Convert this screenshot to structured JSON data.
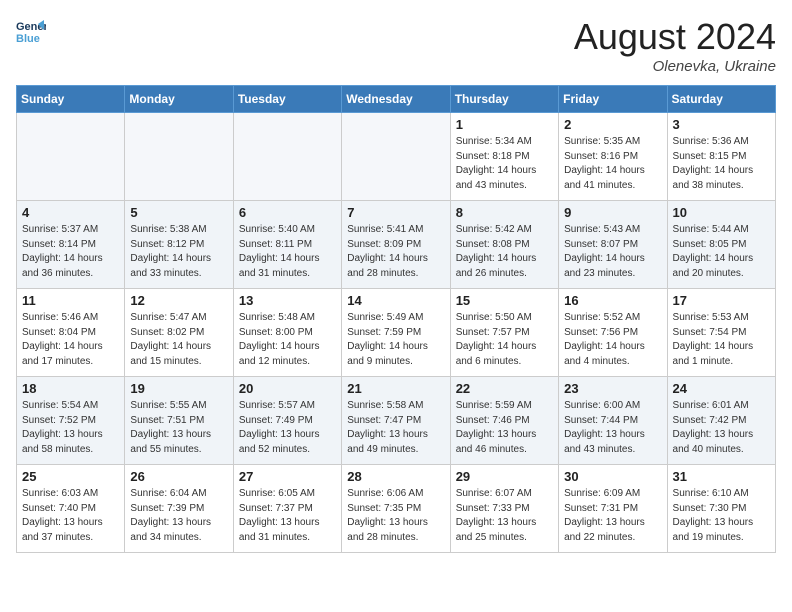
{
  "header": {
    "logo_line1": "General",
    "logo_line2": "Blue",
    "month_title": "August 2024",
    "location": "Olenevka, Ukraine"
  },
  "days_of_week": [
    "Sunday",
    "Monday",
    "Tuesday",
    "Wednesday",
    "Thursday",
    "Friday",
    "Saturday"
  ],
  "weeks": [
    [
      {
        "day": "",
        "info": ""
      },
      {
        "day": "",
        "info": ""
      },
      {
        "day": "",
        "info": ""
      },
      {
        "day": "",
        "info": ""
      },
      {
        "day": "1",
        "info": "Sunrise: 5:34 AM\nSunset: 8:18 PM\nDaylight: 14 hours\nand 43 minutes."
      },
      {
        "day": "2",
        "info": "Sunrise: 5:35 AM\nSunset: 8:16 PM\nDaylight: 14 hours\nand 41 minutes."
      },
      {
        "day": "3",
        "info": "Sunrise: 5:36 AM\nSunset: 8:15 PM\nDaylight: 14 hours\nand 38 minutes."
      }
    ],
    [
      {
        "day": "4",
        "info": "Sunrise: 5:37 AM\nSunset: 8:14 PM\nDaylight: 14 hours\nand 36 minutes."
      },
      {
        "day": "5",
        "info": "Sunrise: 5:38 AM\nSunset: 8:12 PM\nDaylight: 14 hours\nand 33 minutes."
      },
      {
        "day": "6",
        "info": "Sunrise: 5:40 AM\nSunset: 8:11 PM\nDaylight: 14 hours\nand 31 minutes."
      },
      {
        "day": "7",
        "info": "Sunrise: 5:41 AM\nSunset: 8:09 PM\nDaylight: 14 hours\nand 28 minutes."
      },
      {
        "day": "8",
        "info": "Sunrise: 5:42 AM\nSunset: 8:08 PM\nDaylight: 14 hours\nand 26 minutes."
      },
      {
        "day": "9",
        "info": "Sunrise: 5:43 AM\nSunset: 8:07 PM\nDaylight: 14 hours\nand 23 minutes."
      },
      {
        "day": "10",
        "info": "Sunrise: 5:44 AM\nSunset: 8:05 PM\nDaylight: 14 hours\nand 20 minutes."
      }
    ],
    [
      {
        "day": "11",
        "info": "Sunrise: 5:46 AM\nSunset: 8:04 PM\nDaylight: 14 hours\nand 17 minutes."
      },
      {
        "day": "12",
        "info": "Sunrise: 5:47 AM\nSunset: 8:02 PM\nDaylight: 14 hours\nand 15 minutes."
      },
      {
        "day": "13",
        "info": "Sunrise: 5:48 AM\nSunset: 8:00 PM\nDaylight: 14 hours\nand 12 minutes."
      },
      {
        "day": "14",
        "info": "Sunrise: 5:49 AM\nSunset: 7:59 PM\nDaylight: 14 hours\nand 9 minutes."
      },
      {
        "day": "15",
        "info": "Sunrise: 5:50 AM\nSunset: 7:57 PM\nDaylight: 14 hours\nand 6 minutes."
      },
      {
        "day": "16",
        "info": "Sunrise: 5:52 AM\nSunset: 7:56 PM\nDaylight: 14 hours\nand 4 minutes."
      },
      {
        "day": "17",
        "info": "Sunrise: 5:53 AM\nSunset: 7:54 PM\nDaylight: 14 hours\nand 1 minute."
      }
    ],
    [
      {
        "day": "18",
        "info": "Sunrise: 5:54 AM\nSunset: 7:52 PM\nDaylight: 13 hours\nand 58 minutes."
      },
      {
        "day": "19",
        "info": "Sunrise: 5:55 AM\nSunset: 7:51 PM\nDaylight: 13 hours\nand 55 minutes."
      },
      {
        "day": "20",
        "info": "Sunrise: 5:57 AM\nSunset: 7:49 PM\nDaylight: 13 hours\nand 52 minutes."
      },
      {
        "day": "21",
        "info": "Sunrise: 5:58 AM\nSunset: 7:47 PM\nDaylight: 13 hours\nand 49 minutes."
      },
      {
        "day": "22",
        "info": "Sunrise: 5:59 AM\nSunset: 7:46 PM\nDaylight: 13 hours\nand 46 minutes."
      },
      {
        "day": "23",
        "info": "Sunrise: 6:00 AM\nSunset: 7:44 PM\nDaylight: 13 hours\nand 43 minutes."
      },
      {
        "day": "24",
        "info": "Sunrise: 6:01 AM\nSunset: 7:42 PM\nDaylight: 13 hours\nand 40 minutes."
      }
    ],
    [
      {
        "day": "25",
        "info": "Sunrise: 6:03 AM\nSunset: 7:40 PM\nDaylight: 13 hours\nand 37 minutes."
      },
      {
        "day": "26",
        "info": "Sunrise: 6:04 AM\nSunset: 7:39 PM\nDaylight: 13 hours\nand 34 minutes."
      },
      {
        "day": "27",
        "info": "Sunrise: 6:05 AM\nSunset: 7:37 PM\nDaylight: 13 hours\nand 31 minutes."
      },
      {
        "day": "28",
        "info": "Sunrise: 6:06 AM\nSunset: 7:35 PM\nDaylight: 13 hours\nand 28 minutes."
      },
      {
        "day": "29",
        "info": "Sunrise: 6:07 AM\nSunset: 7:33 PM\nDaylight: 13 hours\nand 25 minutes."
      },
      {
        "day": "30",
        "info": "Sunrise: 6:09 AM\nSunset: 7:31 PM\nDaylight: 13 hours\nand 22 minutes."
      },
      {
        "day": "31",
        "info": "Sunrise: 6:10 AM\nSunset: 7:30 PM\nDaylight: 13 hours\nand 19 minutes."
      }
    ]
  ]
}
